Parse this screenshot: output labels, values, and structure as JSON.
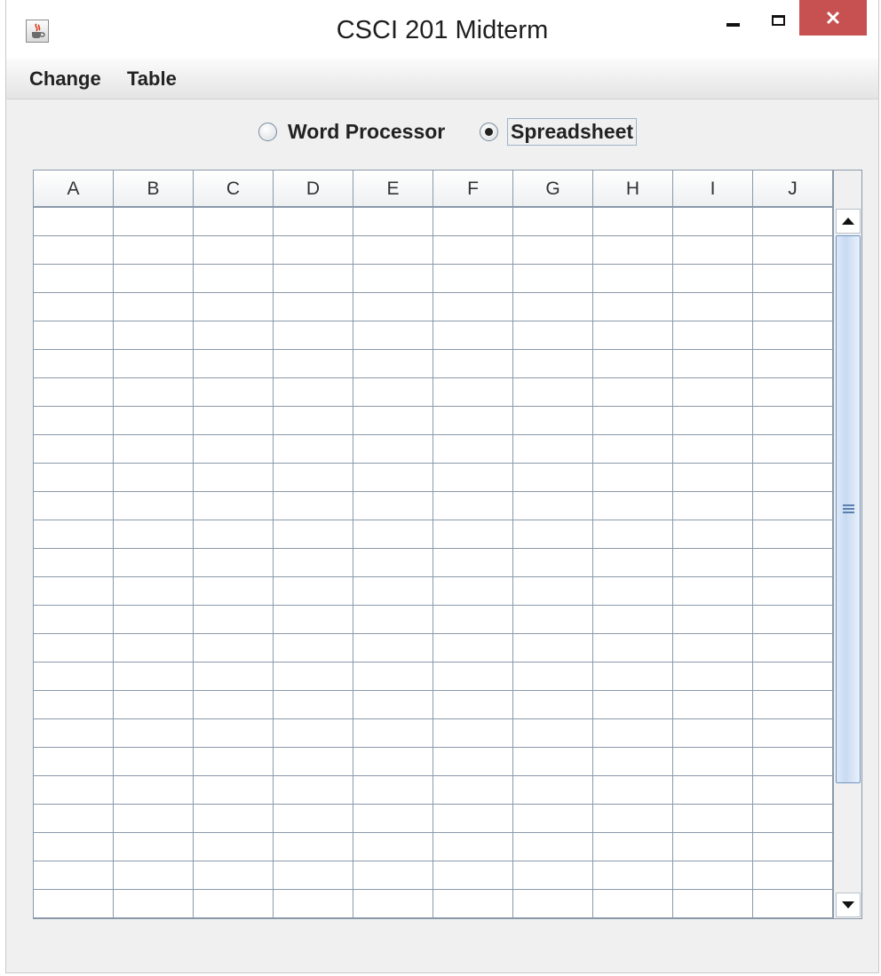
{
  "window": {
    "title": "CSCI 201 Midterm",
    "icon": "java-cup-icon"
  },
  "menubar": {
    "items": [
      "Change",
      "Table"
    ]
  },
  "mode": {
    "options": [
      "Word Processor",
      "Spreadsheet"
    ],
    "selected": "Spreadsheet"
  },
  "table": {
    "columns": [
      "A",
      "B",
      "C",
      "D",
      "E",
      "F",
      "G",
      "H",
      "I",
      "J"
    ]
  },
  "scrollbar": {
    "position_fraction": 0.0,
    "visible_fraction": 0.8
  },
  "colors": {
    "close_button": "#c75050",
    "grid_lines": "#8a99aa",
    "scroll_thumb": "#c8daf2"
  }
}
